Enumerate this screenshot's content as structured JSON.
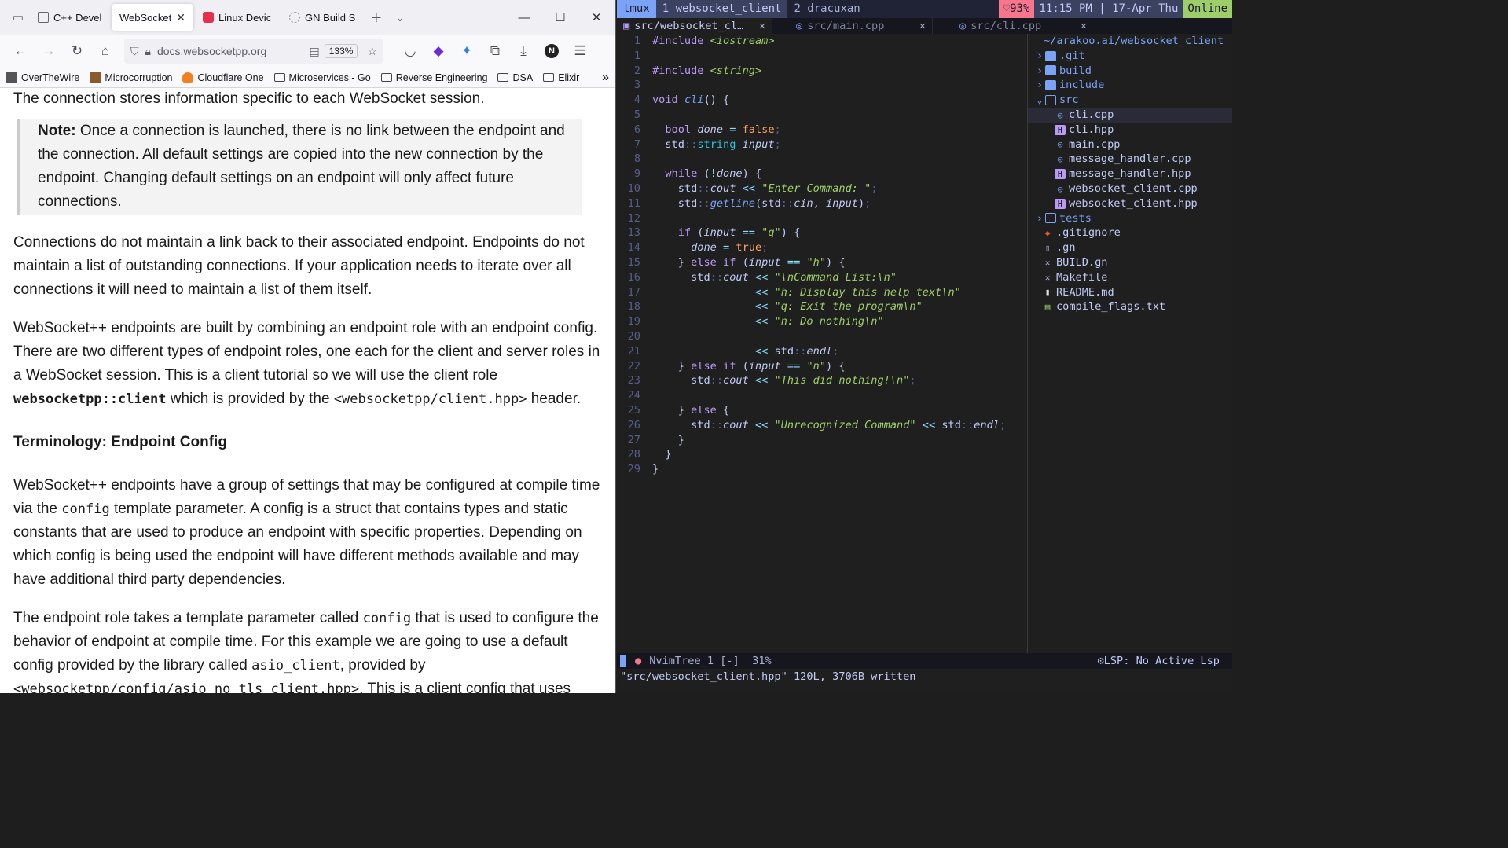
{
  "browser": {
    "tabs": [
      {
        "label": "C++ Develo",
        "active": false
      },
      {
        "label": "WebSocket+",
        "active": true
      },
      {
        "label": "Linux Devic",
        "active": false
      },
      {
        "label": "GN Build Sy",
        "active": false
      }
    ],
    "url": "docs.websocketpp.org",
    "zoom": "133%",
    "bookmarks": [
      "OverTheWire",
      "Microcorruption",
      "Cloudflare One",
      "Microservices - Go",
      "Reverse Engineering",
      "DSA",
      "Elixir"
    ],
    "page": {
      "p0": "The connection stores information specific to each WebSocket session.",
      "note_label": "Note:",
      "note_text": " Once a connection is launched, there is no link between the endpoint and the connection. All default settings are copied into the new connection by the endpoint. Changing default settings on an endpoint will only affect future connections.",
      "p1": "Connections do not maintain a link back to their associated endpoint. Endpoints do not maintain a list of outstanding connections. If your application needs to iterate over all connections it will need to maintain a list of them itself.",
      "p2a": "WebSocket++ endpoints are built by combining an endpoint role with an endpoint config. There are two different types of endpoint roles, one each for the client and server roles in a WebSocket session. This is a client tutorial so we will use the client role ",
      "p2code": "websocketpp::client",
      "p2b": " which is provided by the ",
      "p2code2": "<websocketpp/client.hpp>",
      "p2c": " header.",
      "heading": "Terminology: Endpoint Config",
      "p3a": "WebSocket++ endpoints have a group of settings that may be configured at compile time via the ",
      "p3code": "config",
      "p3b": " template parameter. A config is a struct that contains types and static constants that are used to produce an endpoint with specific properties. Depending on which config is being used the endpoint will have different methods available and may have additional third party dependencies.",
      "p4a": "The endpoint role takes a template parameter called ",
      "p4code": "config",
      "p4b": " that is used to configure the behavior of endpoint at compile time. For this example we are going to use a default config provided by the library called ",
      "p4code2": "asio_client",
      "p4c": ", provided by",
      "p4code3": "<websocketpp/config/asio_no_tls_client.hpp>",
      "p4d": ". This is a client config that uses"
    }
  },
  "tmux": {
    "session": "tmux",
    "windows": [
      "1 websocket_client",
      "2 dracuxan"
    ],
    "battery": "♡93%",
    "clock": "11:15 PM | 17-Apr Thu",
    "status": "Online"
  },
  "nvim": {
    "buffers": [
      {
        "name": "src/websocket_cl…",
        "kind": "h"
      },
      {
        "name": "src/main.cpp",
        "kind": "c"
      },
      {
        "name": "src/cli.cpp",
        "kind": "c"
      }
    ],
    "tree_root": "~/arakoo.ai/websocket_client",
    "tree": [
      {
        "name": ".git",
        "type": "dir",
        "open": false
      },
      {
        "name": "build",
        "type": "dir",
        "open": false
      },
      {
        "name": "include",
        "type": "dir",
        "open": false
      },
      {
        "name": "src",
        "type": "dir",
        "open": true
      },
      {
        "name": "cli.cpp",
        "type": "cpp",
        "indent": 1
      },
      {
        "name": "cli.hpp",
        "type": "hpp",
        "indent": 1
      },
      {
        "name": "main.cpp",
        "type": "cpp",
        "indent": 1
      },
      {
        "name": "message_handler.cpp",
        "type": "cpp",
        "indent": 1
      },
      {
        "name": "message_handler.hpp",
        "type": "hpp",
        "indent": 1
      },
      {
        "name": "websocket_client.cpp",
        "type": "cpp",
        "indent": 1
      },
      {
        "name": "websocket_client.hpp",
        "type": "hpp",
        "indent": 1
      },
      {
        "name": "tests",
        "type": "dir-empty",
        "open": false
      },
      {
        "name": ".gitignore",
        "type": "git"
      },
      {
        "name": ".gn",
        "type": "plain"
      },
      {
        "name": "BUILD.gn",
        "type": "x"
      },
      {
        "name": "Makefile",
        "type": "x"
      },
      {
        "name": "README.md",
        "type": "md"
      },
      {
        "name": "compile_flags.txt",
        "type": "txt"
      }
    ],
    "status_left": "NvimTree_1 [-]  31%",
    "status_right": "LSP: No Active Lsp",
    "cmdline": "\"src/websocket_client.hpp\" 120L, 3706B written"
  }
}
